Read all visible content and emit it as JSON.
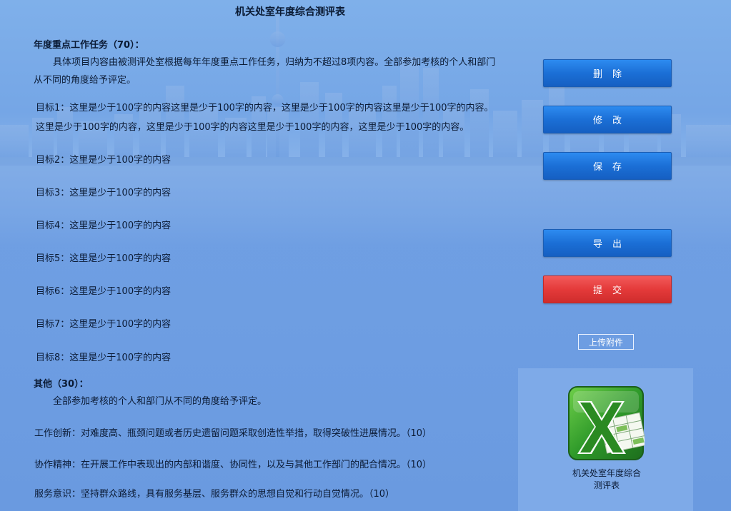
{
  "page": {
    "title": "机关处室年度综合测评表"
  },
  "key_tasks": {
    "heading": "年度重点工作任务（70）：",
    "description": "具体项目内容由被测评处室根据每年年度重点工作任务，归纳为不超过8项内容。全部参加考核的个人和部门",
    "description_cont": "从不同的角度给予评定。",
    "goal1_line1": "目标1：这里是少于100字的内容这里是少于100字的内容，这里是少于100字的内容这里是少于100字的内容。",
    "goal1_line2": "这里是少于100字的内容，这里是少于100字的内容这里是少于100字的内容，这里是少于100字的内容。",
    "goals": [
      "目标2：这里是少于100字的内容",
      "目标3：这里是少于100字的内容",
      "目标4：这里是少于100字的内容",
      "目标5：这里是少于100字的内容",
      "目标6：这里是少于100字的内容",
      "目标7：这里是少于100字的内容",
      "目标8：这里是少于100字的内容"
    ]
  },
  "others": {
    "heading": "其他（30）：",
    "description": "全部参加考核的个人和部门从不同的角度给予评定。",
    "items": [
      "工作创新：对难度高、瓶颈问题或者历史遗留问题采取创造性举措，取得突破性进展情况。（10）",
      "协作精神：在开展工作中表现出的内部和谐度、协同性，以及与其他工作部门的配合情况。（10）",
      "服务意识：坚持群众路线，具有服务基层、服务群众的思想自觉和行动自觉情况。（10）"
    ]
  },
  "actions": {
    "delete": "删除",
    "edit": "修改",
    "save": "保存",
    "export": "导出",
    "submit": "提交",
    "upload": "上传附件"
  },
  "attachment": {
    "icon": "excel-file-icon",
    "name_line1": "机关处室年度综合",
    "name_line2": "测评表"
  },
  "colors": {
    "primary_button": "#1b6fd6",
    "danger_button": "#e43a3a",
    "background": "#7aa8e6"
  }
}
